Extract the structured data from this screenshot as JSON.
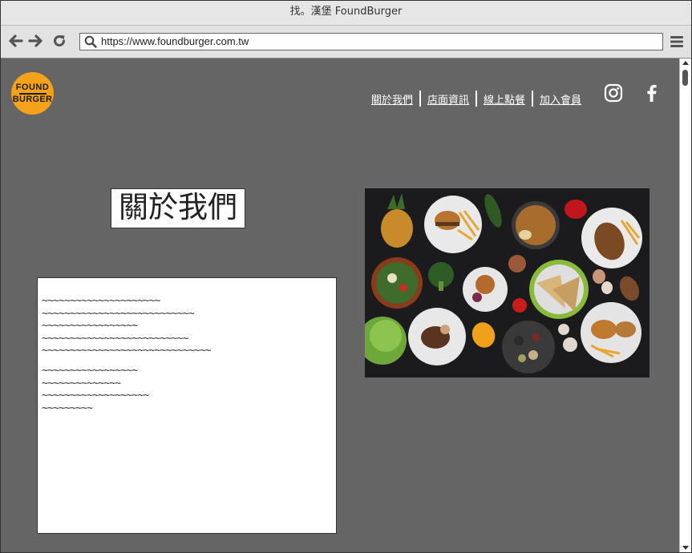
{
  "window": {
    "title": "找。漢堡  FoundBurger"
  },
  "toolbar": {
    "url": "https://www.foundburger.com.tw",
    "back_icon": "arrow-left-icon",
    "forward_icon": "arrow-right-icon",
    "reload_icon": "reload-icon",
    "menu_icon": "hamburger-menu-icon"
  },
  "logo": {
    "line1": "FOUND",
    "line2": "BURGER",
    "color": "#f4a21a"
  },
  "nav": {
    "items": [
      {
        "label": "關於我們"
      },
      {
        "label": "店面資訊"
      },
      {
        "label": "線上點餐"
      },
      {
        "label": "加入會員"
      }
    ]
  },
  "social": {
    "instagram_icon": "instagram-icon",
    "facebook_icon": "facebook-icon"
  },
  "about": {
    "title": "關於我們",
    "paragraphs": [
      [
        "~~~~~~~~~~~~~~~~~~~~~",
        "~~~~~~~~~~~~~~~~~~~~~~~~~~~",
        "~~~~~~~~~~~~~~~~~",
        "~~~~~~~~~~~~~~~~~~~~~~~~~~",
        "~~~~~~~~~~~~~~~~~~~~~~~~~~~~~~"
      ],
      [
        "~~~~~~~~~~~~~~~~~",
        "~~~~~~~~~~~~~~",
        "~~~~~~~~~~~~~~~~~~~",
        "~~~~~~~~~"
      ]
    ]
  },
  "colors": {
    "page_background": "#656565",
    "accent": "#f4a21a"
  }
}
